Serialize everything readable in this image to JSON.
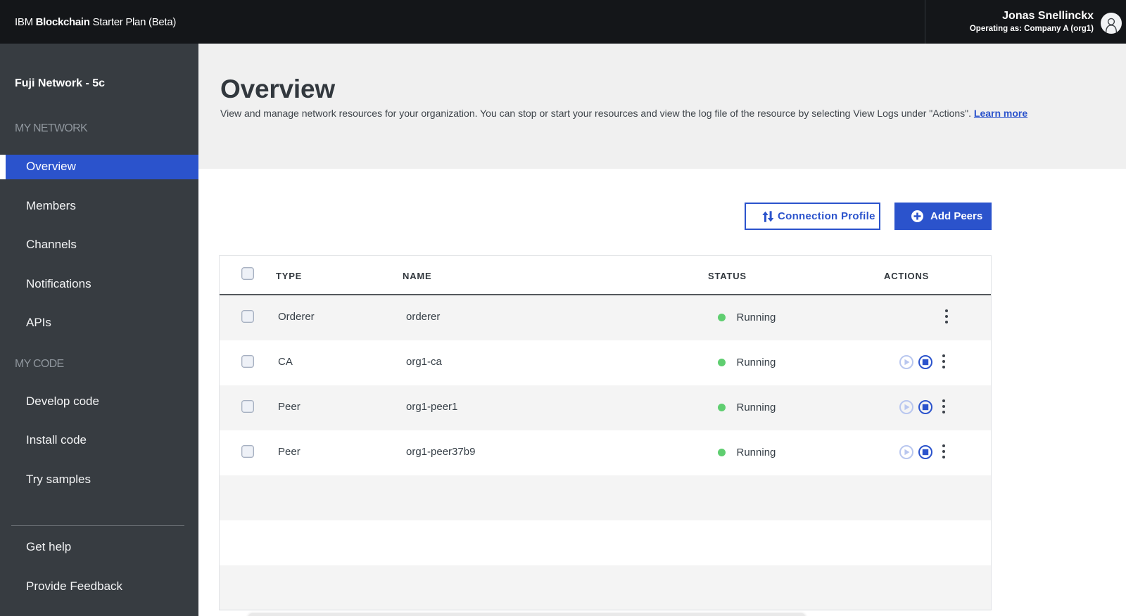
{
  "colors": {
    "accent_blue": "#2b53cc",
    "header_bg": "#141619",
    "sidebar_bg": "#373c41",
    "hero_bg": "#f0f0f0",
    "zebra_gray": "#f4f4f4",
    "status_green": "#5fce70"
  },
  "header": {
    "brand_prefix": "IBM ",
    "brand_bold": "Blockchain",
    "brand_suffix": " Starter Plan (Beta)",
    "user_name": "Jonas Snellinckx",
    "operating_as": "Operating as: Company A (org1)"
  },
  "sidebar": {
    "network_title": "Fuji Network - 5c",
    "sections": [
      {
        "label": "MY NETWORK",
        "items": [
          {
            "label": "Overview",
            "selected": true
          },
          {
            "label": "Members",
            "selected": false
          },
          {
            "label": "Channels",
            "selected": false
          },
          {
            "label": "Notifications",
            "selected": false
          },
          {
            "label": "APIs",
            "selected": false
          }
        ]
      },
      {
        "label": "MY CODE",
        "items": [
          {
            "label": "Develop code",
            "selected": false
          },
          {
            "label": "Install code",
            "selected": false
          },
          {
            "label": "Try samples",
            "selected": false
          }
        ]
      }
    ],
    "footer_items": [
      {
        "label": "Get help"
      },
      {
        "label": "Provide Feedback"
      }
    ]
  },
  "main": {
    "title": "Overview",
    "description": "View and manage network resources for your organization. You can stop or start your resources and view the log file of the resource by selecting View Logs under \"Actions\". ",
    "learn_more": "Learn more",
    "connection_profile_label": "Connection Profile",
    "add_peers_label": "Add Peers"
  },
  "table": {
    "columns": {
      "type": "TYPE",
      "name": "NAME",
      "status": "STATUS",
      "actions": "ACTIONS"
    },
    "rows": [
      {
        "type": "Orderer",
        "name": "orderer",
        "status": "Running",
        "has_start_stop": false
      },
      {
        "type": "CA",
        "name": "org1-ca",
        "status": "Running",
        "has_start_stop": true
      },
      {
        "type": "Peer",
        "name": "org1-peer1",
        "status": "Running",
        "has_start_stop": true
      },
      {
        "type": "Peer",
        "name": "org1-peer37b9",
        "status": "Running",
        "has_start_stop": true
      }
    ],
    "empty_rows": 3
  }
}
